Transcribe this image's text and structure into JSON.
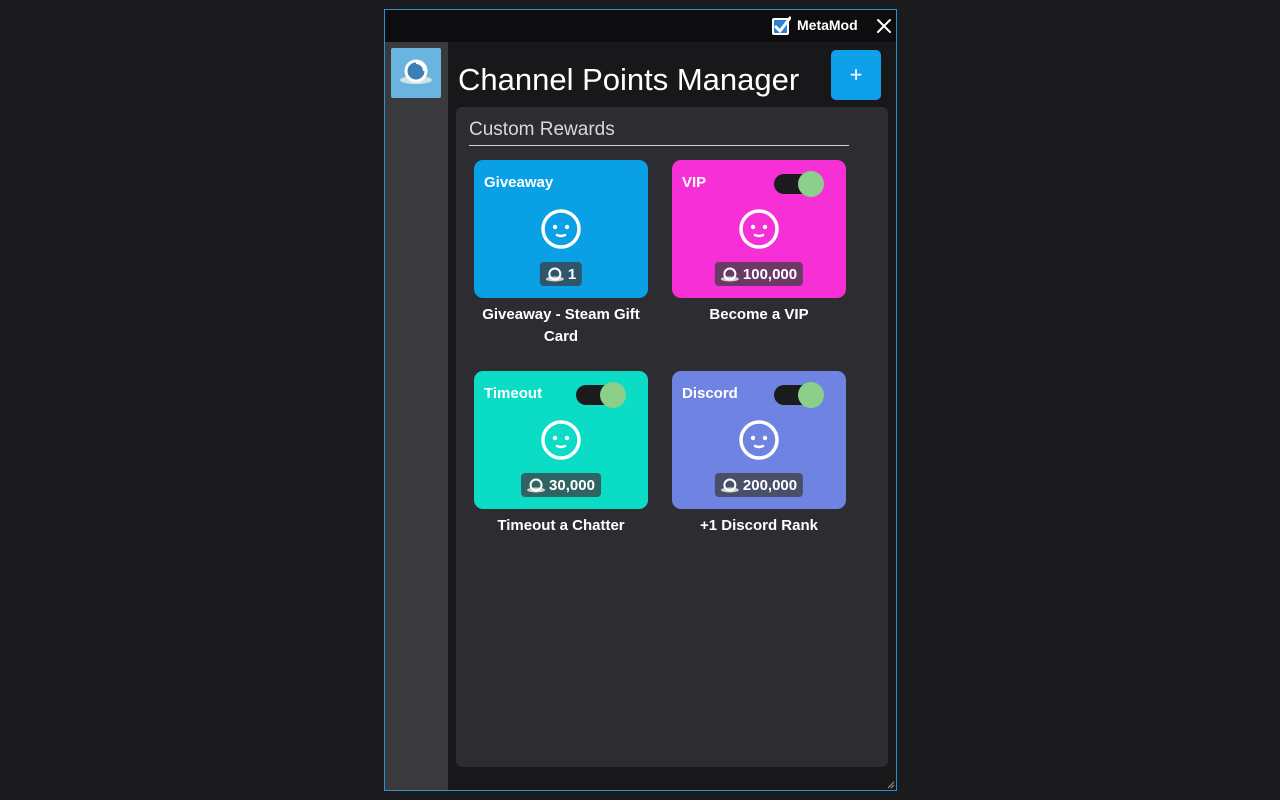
{
  "titlebar": {
    "app_name": "MetaMod",
    "icons": {
      "check": "checkbox-checked-icon",
      "close": "close-icon"
    }
  },
  "sidebar": {
    "logo_icon": "channel-points-icon"
  },
  "header": {
    "title": "Channel Points Manager",
    "add_label": "+"
  },
  "section": {
    "title": "Custom Rewards"
  },
  "rewards": [
    {
      "tag": "Giveaway",
      "cost": "1",
      "name": "Giveaway - Steam Gift Card",
      "color": "#09a0e6",
      "has_toggle": false,
      "enabled": false
    },
    {
      "tag": "VIP",
      "cost": "100,000",
      "name": "Become a VIP",
      "color": "#f630d6",
      "has_toggle": true,
      "enabled": true
    },
    {
      "tag": "Timeout",
      "cost": "30,000",
      "name": "Timeout a Chatter",
      "color": "#0bdcc6",
      "has_toggle": true,
      "enabled": true
    },
    {
      "tag": "Discord",
      "cost": "200,000",
      "name": "+1 Discord Rank",
      "color": "#6f84e2",
      "has_toggle": true,
      "enabled": true
    }
  ],
  "colors": {
    "accent": "#0ea0e8",
    "toggle_on": "#8ccf8a",
    "window_border": "#2a8fd6"
  }
}
